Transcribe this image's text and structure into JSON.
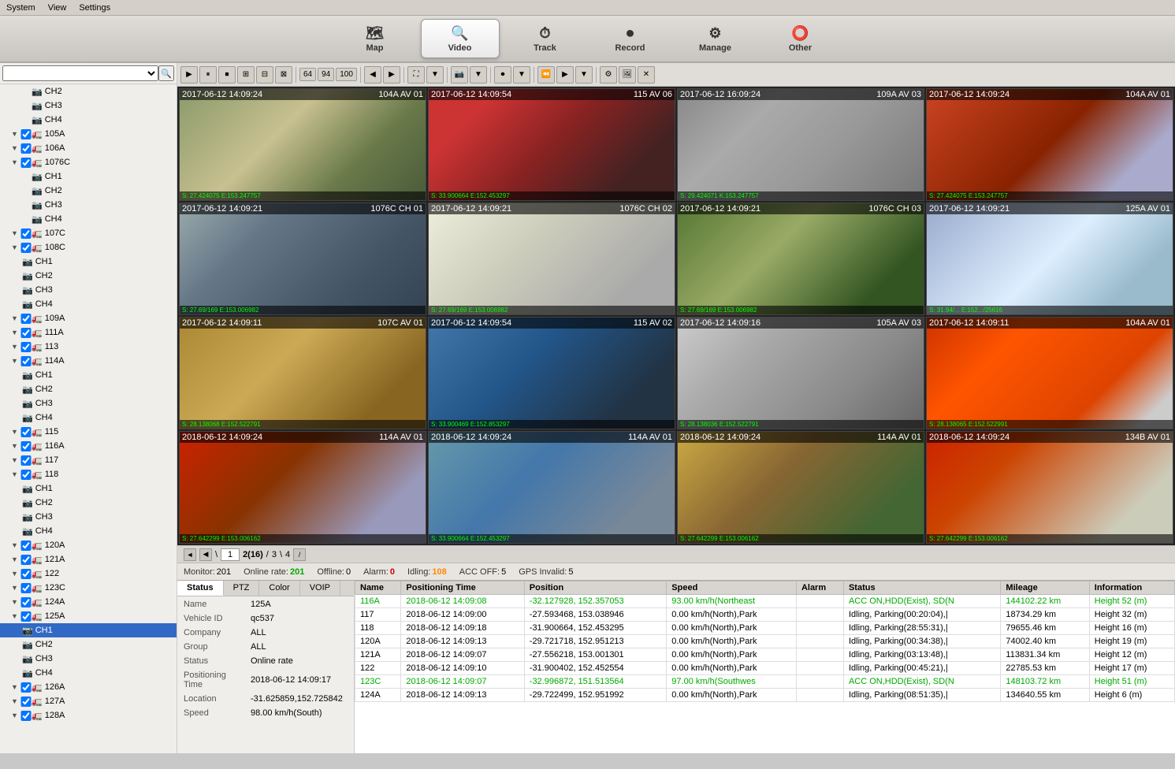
{
  "menubar": {
    "items": [
      "System",
      "View",
      "Settings"
    ]
  },
  "navtabs": [
    {
      "id": "map",
      "label": "Map",
      "icon": "🗺",
      "active": false
    },
    {
      "id": "video",
      "label": "Video",
      "icon": "🔍",
      "active": true
    },
    {
      "id": "track",
      "label": "Track",
      "icon": "⏱",
      "active": false
    },
    {
      "id": "record",
      "label": "Record",
      "icon": "⏺",
      "active": false
    },
    {
      "id": "manage",
      "label": "Manage",
      "icon": "⚙",
      "active": false
    },
    {
      "id": "other",
      "label": "Other",
      "icon": "⭕",
      "active": false
    }
  ],
  "sidebar": {
    "search_placeholder": "",
    "items": [
      {
        "level": "indent2",
        "type": "channel",
        "label": "CH2",
        "expand": false
      },
      {
        "level": "indent2",
        "type": "channel",
        "label": "CH3",
        "expand": false
      },
      {
        "level": "indent2",
        "type": "channel",
        "label": "CH4",
        "expand": false
      },
      {
        "level": "indent1",
        "type": "vehicle",
        "label": "105A",
        "checked": true,
        "expand": true
      },
      {
        "level": "indent1",
        "type": "vehicle",
        "label": "106A",
        "checked": true,
        "expand": true
      },
      {
        "level": "indent1",
        "type": "vehicle",
        "label": "1076C",
        "checked": true,
        "expand": true
      },
      {
        "level": "indent2",
        "type": "channel",
        "label": "CH1",
        "expand": false
      },
      {
        "level": "indent2",
        "type": "channel",
        "label": "CH2",
        "expand": false
      },
      {
        "level": "indent2",
        "type": "channel",
        "label": "CH3",
        "expand": false
      },
      {
        "level": "indent2",
        "type": "channel",
        "label": "CH4",
        "expand": false
      },
      {
        "level": "indent1",
        "type": "vehicle",
        "label": "107C",
        "checked": true,
        "expand": true
      },
      {
        "level": "indent1",
        "type": "vehicle",
        "label": "108C",
        "checked": true,
        "expand": true
      },
      {
        "level": "indent2",
        "type": "channel",
        "label": "CH1",
        "expand": false
      },
      {
        "level": "indent2",
        "type": "channel",
        "label": "CH2",
        "expand": false
      },
      {
        "level": "indent2",
        "type": "channel",
        "label": "CH3",
        "expand": false
      },
      {
        "level": "indent2",
        "type": "channel",
        "label": "CH4",
        "expand": false
      },
      {
        "level": "indent1",
        "type": "vehicle",
        "label": "109A",
        "checked": true,
        "expand": true
      },
      {
        "level": "indent1",
        "type": "vehicle",
        "label": "111A",
        "checked": true,
        "expand": true
      },
      {
        "level": "indent1",
        "type": "vehicle",
        "label": "113",
        "checked": true,
        "expand": true
      },
      {
        "level": "indent1",
        "type": "vehicle",
        "label": "114A",
        "checked": true,
        "expand": true
      },
      {
        "level": "indent2",
        "type": "channel",
        "label": "CH1",
        "expand": false
      },
      {
        "level": "indent2",
        "type": "channel",
        "label": "CH2",
        "expand": false
      },
      {
        "level": "indent2",
        "type": "channel",
        "label": "CH3",
        "expand": false
      },
      {
        "level": "indent2",
        "type": "channel",
        "label": "CH4",
        "expand": false
      },
      {
        "level": "indent1",
        "type": "vehicle",
        "label": "115",
        "checked": true,
        "expand": true
      },
      {
        "level": "indent1",
        "type": "vehicle",
        "label": "116A",
        "checked": true,
        "expand": true
      },
      {
        "level": "indent1",
        "type": "vehicle",
        "label": "117",
        "checked": true,
        "expand": true
      },
      {
        "level": "indent1",
        "type": "vehicle",
        "label": "118",
        "checked": true,
        "expand": true
      },
      {
        "level": "indent2",
        "type": "channel",
        "label": "CH1",
        "expand": false
      },
      {
        "level": "indent2",
        "type": "channel",
        "label": "CH2",
        "expand": false
      },
      {
        "level": "indent2",
        "type": "channel",
        "label": "CH3",
        "expand": false
      },
      {
        "level": "indent2",
        "type": "channel",
        "label": "CH4",
        "expand": false
      },
      {
        "level": "indent1",
        "type": "vehicle",
        "label": "120A",
        "checked": true,
        "expand": true
      },
      {
        "level": "indent1",
        "type": "vehicle",
        "label": "121A",
        "checked": true,
        "expand": true
      },
      {
        "level": "indent1",
        "type": "vehicle",
        "label": "122",
        "checked": true,
        "expand": true
      },
      {
        "level": "indent1",
        "type": "vehicle",
        "label": "123C",
        "checked": true,
        "expand": true
      },
      {
        "level": "indent1",
        "type": "vehicle",
        "label": "124A",
        "checked": true,
        "expand": true
      },
      {
        "level": "indent1",
        "type": "vehicle",
        "label": "125A",
        "checked": true,
        "expand": true
      },
      {
        "level": "indent2",
        "type": "channel",
        "label": "CH1",
        "expand": false,
        "selected": true
      },
      {
        "level": "indent2",
        "type": "channel",
        "label": "CH2",
        "expand": false
      },
      {
        "level": "indent2",
        "type": "channel",
        "label": "CH3",
        "expand": false
      },
      {
        "level": "indent2",
        "type": "channel",
        "label": "CH4",
        "expand": false
      },
      {
        "level": "indent1",
        "type": "vehicle",
        "label": "126A",
        "checked": true,
        "expand": true
      },
      {
        "level": "indent1",
        "type": "vehicle",
        "label": "127A",
        "checked": true,
        "expand": true
      },
      {
        "level": "indent1",
        "type": "vehicle",
        "label": "128A",
        "checked": true,
        "expand": true
      }
    ]
  },
  "video_cells": [
    {
      "id": 1,
      "label": "104A AV 01",
      "timestamp": "2017-06-12 14:09:24",
      "gps": "S: 27.424075 E:153.247757",
      "cam_class": "cam-1"
    },
    {
      "id": 2,
      "label": "115 AV 06",
      "timestamp": "2017-06-12 14:09:54",
      "gps": "S: 33.900664 E:152.453297",
      "cam_class": "cam-2"
    },
    {
      "id": 3,
      "label": "109A AV 03",
      "timestamp": "2017-06-12 16:09:24",
      "gps": "S: 29.424071 K:153.247757",
      "cam_class": "cam-3"
    },
    {
      "id": 4,
      "label": "104A AV 01",
      "timestamp": "2017-06-12 14:09:24",
      "gps": "S: 27.424075 E:153.247757",
      "cam_class": "cam-4"
    },
    {
      "id": 5,
      "label": "1076C CH 01",
      "timestamp": "2017-06-12 14:09:21",
      "gps": "S: 27.69/169 E:153.006982",
      "cam_class": "cam-5"
    },
    {
      "id": 6,
      "label": "1076C CH 02",
      "timestamp": "2017-06-12 14:09:21",
      "gps": "S: 27.69/169 E:153.006982",
      "cam_class": "cam-6"
    },
    {
      "id": 7,
      "label": "1076C CH 03",
      "timestamp": "2017-06-12 14:09:21",
      "gps": "S: 27.69/169 E:153.006982",
      "cam_class": "cam-7"
    },
    {
      "id": 8,
      "label": "125A AV 01",
      "timestamp": "2017-06-12 14:09:21",
      "gps": "S: 31.94/... E:152.../25616",
      "cam_class": "cam-8"
    },
    {
      "id": 9,
      "label": "107C AV 01",
      "timestamp": "2017-06-12 14:09:11",
      "gps": "S: 28.138068 E:152.522791",
      "cam_class": "cam-9"
    },
    {
      "id": 10,
      "label": "115 AV 02",
      "timestamp": "2017-06-12 14:09:54",
      "gps": "S: 33.900469 E:152.853297",
      "cam_class": "cam-10"
    },
    {
      "id": 11,
      "label": "105A AV 03",
      "timestamp": "2017-06-12 14:09:16",
      "gps": "S: 28.138036 E:152.522791",
      "cam_class": "cam-11"
    },
    {
      "id": 12,
      "label": "104A AV 01",
      "timestamp": "2017-06-12 14:09:11",
      "gps": "S: 28.138065 E:152.522991",
      "cam_class": "cam-12"
    },
    {
      "id": 13,
      "label": "114A AV 01",
      "timestamp": "2018-06-12 14:09:24",
      "gps": "S: 27.642299 E:153.006162",
      "cam_class": "cam-13"
    },
    {
      "id": 14,
      "label": "114A AV 01",
      "timestamp": "2018-06-12 14:09:24",
      "gps": "S: 33.900664 E:152.453297",
      "cam_class": "cam-14"
    },
    {
      "id": 15,
      "label": "114A AV 01",
      "timestamp": "2018-06-12 14:09:24",
      "gps": "S: 27.642299 E:153.006162",
      "cam_class": "cam-15"
    },
    {
      "id": 16,
      "label": "134B AV 01",
      "timestamp": "2018-06-12 14:09:24",
      "gps": "S: 27.642299 E:153.006162",
      "cam_class": "cam-16"
    }
  ],
  "pagination": {
    "prev_label": "◄",
    "prev2_label": "◀",
    "page_input": "1",
    "current_page": "2(16)",
    "slash": "/",
    "next_page": "3",
    "slash2": "\\",
    "last_page": "4",
    "end_label": "/"
  },
  "status_bar": {
    "monitor_label": "Monitor:",
    "monitor_val": "201",
    "online_label": "Online rate:",
    "online_val": "201",
    "offline_label": "Offline:",
    "offline_val": "0",
    "alarm_label": "Alarm:",
    "alarm_val": "0",
    "idling_label": "Idling:",
    "idling_val": "108",
    "accoff_label": "ACC OFF:",
    "accoff_val": "5",
    "gpsinvalid_label": "GPS Invalid:",
    "gpsinvalid_val": "5"
  },
  "bottom_tabs": [
    "Status",
    "PTZ",
    "Color",
    "VOIP"
  ],
  "vehicle_info": {
    "name_label": "Name",
    "name_val": "125A",
    "vehicleid_label": "Vehicle ID",
    "vehicleid_val": "qc537",
    "company_label": "Company",
    "company_val": "ALL",
    "group_label": "Group",
    "group_val": "ALL",
    "status_label": "Status",
    "status_val": "Online rate",
    "postime_label": "Positioning Time",
    "postime_val": "2018-06-12 14:09:17",
    "location_label": "Location",
    "location_val": "-31.625859,152.725842",
    "speed_label": "Speed",
    "speed_val": "98.00 km/h(South)"
  },
  "table_headers": [
    "Name",
    "Positioning Time",
    "Position",
    "Speed",
    "Alarm",
    "Status",
    "Mileage",
    "Information"
  ],
  "table_rows": [
    {
      "name": "116A",
      "postime": "2018-06-12 14:09:08",
      "position": "-32.127928, 152.357053",
      "speed": "93.00 km/h(Northeast",
      "alarm": "",
      "status": "ACC ON,HDD(Exist), SD(N",
      "mileage": "144102.22 km",
      "info": "Height 52 (m)",
      "row_type": "green"
    },
    {
      "name": "117",
      "postime": "2018-06-12 14:09:00",
      "position": "-27.593468, 153.038946",
      "speed": "0.00 km/h(North),Park",
      "alarm": "",
      "status": "Idling, Parking(00:20:04),|",
      "mileage": "18734.29 km",
      "info": "Height 32 (m)",
      "row_type": "black"
    },
    {
      "name": "118",
      "postime": "2018-06-12 14:09:18",
      "position": "-31.900664, 152.453295",
      "speed": "0.00 km/h(North),Park",
      "alarm": "",
      "status": "Idling, Parking(28:55:31),|",
      "mileage": "79655.46 km",
      "info": "Height 16 (m)",
      "row_type": "black"
    },
    {
      "name": "120A",
      "postime": "2018-06-12 14:09:13",
      "position": "-29.721718, 152.951213",
      "speed": "0.00 km/h(North),Park",
      "alarm": "",
      "status": "Idling, Parking(00:34:38),|",
      "mileage": "74002.40 km",
      "info": "Height 19 (m)",
      "row_type": "black"
    },
    {
      "name": "121A",
      "postime": "2018-06-12 14:09:07",
      "position": "-27.556218, 153.001301",
      "speed": "0.00 km/h(North),Park",
      "alarm": "",
      "status": "Idling, Parking(03:13:48),|",
      "mileage": "113831.34 km",
      "info": "Height 12 (m)",
      "row_type": "black"
    },
    {
      "name": "122",
      "postime": "2018-06-12 14:09:10",
      "position": "-31.900402, 152.452554",
      "speed": "0.00 km/h(North),Park",
      "alarm": "",
      "status": "Idling, Parking(00:45:21),|",
      "mileage": "22785.53 km",
      "info": "Height 17 (m)",
      "row_type": "black"
    },
    {
      "name": "123C",
      "postime": "2018-06-12 14:09:07",
      "position": "-32.996872, 151.513564",
      "speed": "97.00 km/h(Southwes",
      "alarm": "",
      "status": "ACC ON,HDD(Exist), SD(N",
      "mileage": "148103.72 km",
      "info": "Height 51 (m)",
      "row_type": "green"
    },
    {
      "name": "124A",
      "postime": "2018-06-12 14:09:13",
      "position": "-29.722499, 152.951992",
      "speed": "0.00 km/h(North),Park",
      "alarm": "",
      "status": "Idling, Parking(08:51:35),|",
      "mileage": "134640.55 km",
      "info": "Height 6 (m)",
      "row_type": "black"
    }
  ]
}
